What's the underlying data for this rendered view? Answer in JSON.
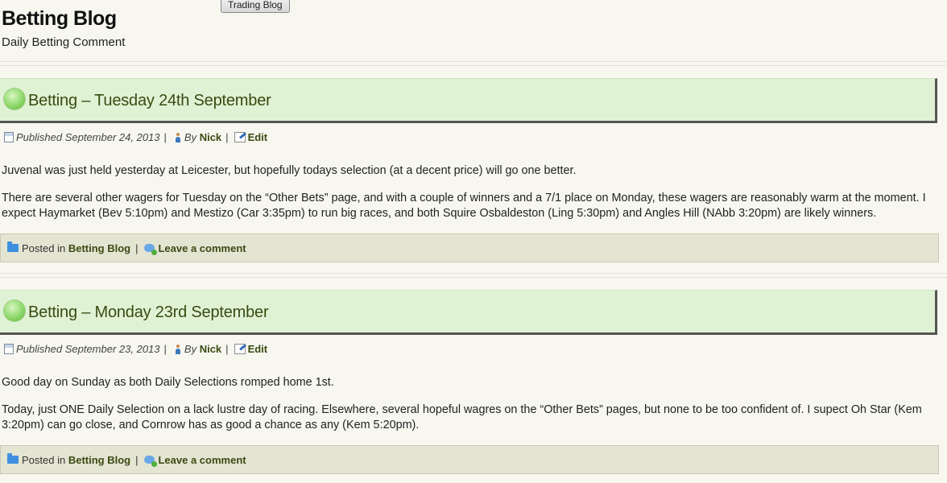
{
  "site": {
    "title": "Betting Blog",
    "description": "Daily Betting Comment",
    "trading_button": "Trading Blog"
  },
  "posts": [
    {
      "title": "Betting – Tuesday 24th September",
      "published": "Published September 24, 2013",
      "by": "By",
      "author": "Nick",
      "edit": "Edit",
      "paragraphs": [
        "Juvenal was just held yesterday at Leicester, but hopefully todays selection (at a decent price) will go one better.",
        "There are several other wagers for Tuesday on the “Other Bets” page, and with a couple of winners and a 7/1 place on Monday, these wagers are reasonably warm at the moment. I expect Haymarket (Bev 5:10pm) and Mestizo (Car 3:35pm) to run big races, and both Squire Osbaldeston (Ling 5:30pm) and Angles Hill (NAbb 3:20pm) are likely winners."
      ],
      "posted_in": "Posted in",
      "category": "Betting Blog",
      "comment": "Leave a comment"
    },
    {
      "title": "Betting – Monday 23rd September",
      "published": "Published September 23, 2013",
      "by": "By",
      "author": "Nick",
      "edit": "Edit",
      "paragraphs": [
        "Good day on Sunday as both Daily Selections romped home 1st.",
        "Today, just ONE Daily Selection on a lack lustre day of racing. Elsewhere, several hopeful wagres on the “Other Bets” pages, but none to be too confident of. I supect Oh Star (Kem 3:20pm) can go close, and Cornrow has as good a chance as any (Kem 5:20pm)."
      ],
      "posted_in": "Posted in",
      "category": "Betting Blog",
      "comment": "Leave a comment"
    }
  ],
  "colors": {
    "title_box_bg": "#e0f2d4",
    "link": "#3a4a12",
    "footer_bg": "#e4e4d2"
  }
}
